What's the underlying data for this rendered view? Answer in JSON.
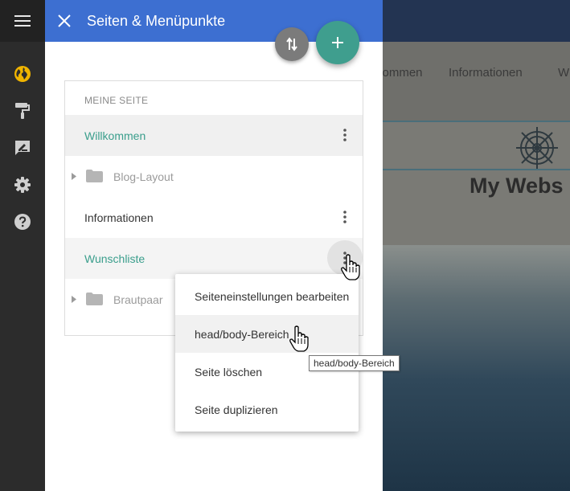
{
  "panel": {
    "title": "Seiten & Menüpunkte",
    "section_label": "MEINE SEITE",
    "pages": [
      {
        "label": "Willkommen",
        "type": "page",
        "selected": true
      },
      {
        "label": "Blog-Layout",
        "type": "folder"
      },
      {
        "label": "Informationen",
        "type": "page"
      },
      {
        "label": "Wunschliste",
        "type": "page",
        "active_menu": true
      },
      {
        "label": "Brautpaar",
        "type": "folder"
      }
    ]
  },
  "context_menu": {
    "items": [
      "Seiteneinstellungen bearbeiten",
      "head/body-Bereich",
      "Seite löschen",
      "Seite duplizieren"
    ],
    "hovered_index": 1
  },
  "tooltip": "head/body-Bereich",
  "preview": {
    "nav": [
      "kommen",
      "Informationen",
      "W"
    ],
    "site_title": "My Webs"
  },
  "icons": {
    "rail": [
      "menu-icon",
      "globe-icon",
      "paint-roller-icon",
      "edit-icon",
      "gear-icon",
      "help-icon"
    ],
    "header": [
      "close-icon"
    ],
    "fabs": [
      "sort-icon",
      "plus-icon"
    ]
  },
  "colors": {
    "header_blue": "#3d6fd1",
    "accent_teal": "#3a9e8c",
    "fab_add": "#3f9e8e",
    "fab_sort": "#7b7b7b",
    "globe_yellow": "#f0b400"
  }
}
